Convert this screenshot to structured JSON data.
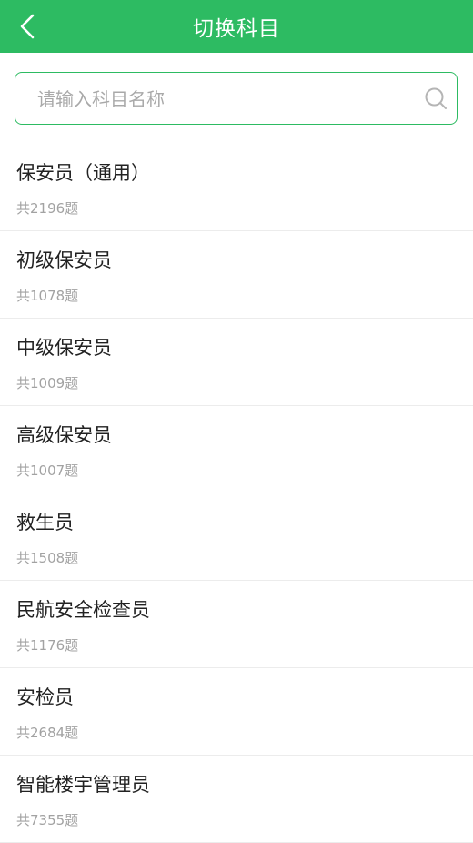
{
  "header": {
    "title": "切换科目",
    "back_icon": "chevron-left-icon"
  },
  "search": {
    "placeholder": "请输入科目名称",
    "value": "",
    "icon": "search-icon"
  },
  "colors": {
    "accent": "#2dbb62",
    "title_text": "#222222",
    "sub_text": "#a2a2a2"
  },
  "subjects": [
    {
      "name": "保安员（通用）",
      "count": "共2196题"
    },
    {
      "name": "初级保安员",
      "count": "共1078题"
    },
    {
      "name": "中级保安员",
      "count": "共1009题"
    },
    {
      "name": "高级保安员",
      "count": "共1007题"
    },
    {
      "name": "救生员",
      "count": "共1508题"
    },
    {
      "name": "民航安全检查员",
      "count": "共1176题"
    },
    {
      "name": "安检员",
      "count": "共2684题"
    },
    {
      "name": "智能楼宇管理员",
      "count": "共7355题"
    }
  ]
}
